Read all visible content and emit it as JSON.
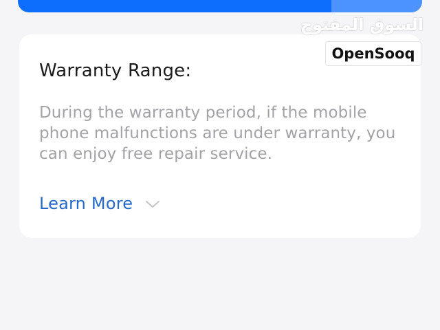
{
  "watermark": {
    "arabic": "السوق المفتوح",
    "latin": "OpenSooq"
  },
  "card": {
    "title": "Warranty Range:",
    "body": "During the warranty period, if the mobile phone malfunctions are under warranty, you can enjoy free repair service.",
    "learn_more_label": "Learn More",
    "learn_more_icon": "chevron-down-icon"
  },
  "colors": {
    "accent_blue": "#0d6efd",
    "link_blue": "#2468c9",
    "body_gray": "#a2a2a7",
    "background": "#f5f5f7"
  }
}
